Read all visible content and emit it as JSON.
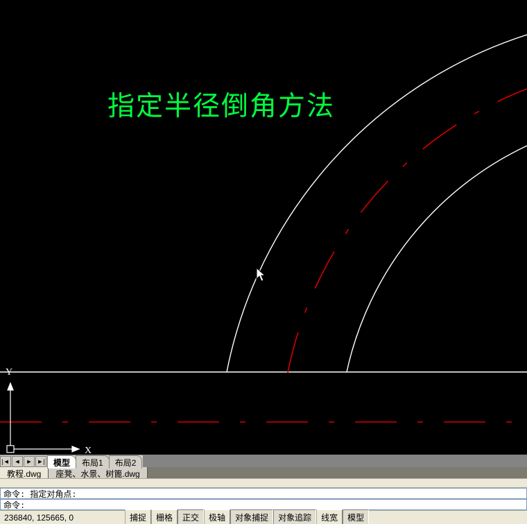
{
  "annotation": {
    "text": "指定半径倒角方法"
  },
  "ucs": {
    "x_label": "X",
    "y_label": "Y"
  },
  "layout_tabs": {
    "nav": {
      "first": "|◄",
      "prev": "◄",
      "next": "►",
      "last": "►|"
    },
    "items": [
      {
        "label": "模型",
        "active": true
      },
      {
        "label": "布局1",
        "active": false
      },
      {
        "label": "布局2",
        "active": false
      }
    ]
  },
  "file_tabs": {
    "items": [
      {
        "label": "教程.dwg",
        "active": true
      },
      {
        "label": "座凳、水景、树篦.dwg",
        "active": false
      }
    ]
  },
  "command": {
    "line1_prefix": "命令:",
    "line1_text": "指定对角点:",
    "line2_prefix": "命令:",
    "line2_text": ""
  },
  "status": {
    "coords": "236840, 125665, 0",
    "buttons": [
      {
        "label": "捕捉",
        "pressed": false
      },
      {
        "label": "栅格",
        "pressed": false
      },
      {
        "label": "正交",
        "pressed": true
      },
      {
        "label": "极轴",
        "pressed": false
      },
      {
        "label": "对象捕捉",
        "pressed": true
      },
      {
        "label": "对象追踪",
        "pressed": true
      },
      {
        "label": "线宽",
        "pressed": false
      },
      {
        "label": "模型",
        "pressed": true
      }
    ]
  }
}
